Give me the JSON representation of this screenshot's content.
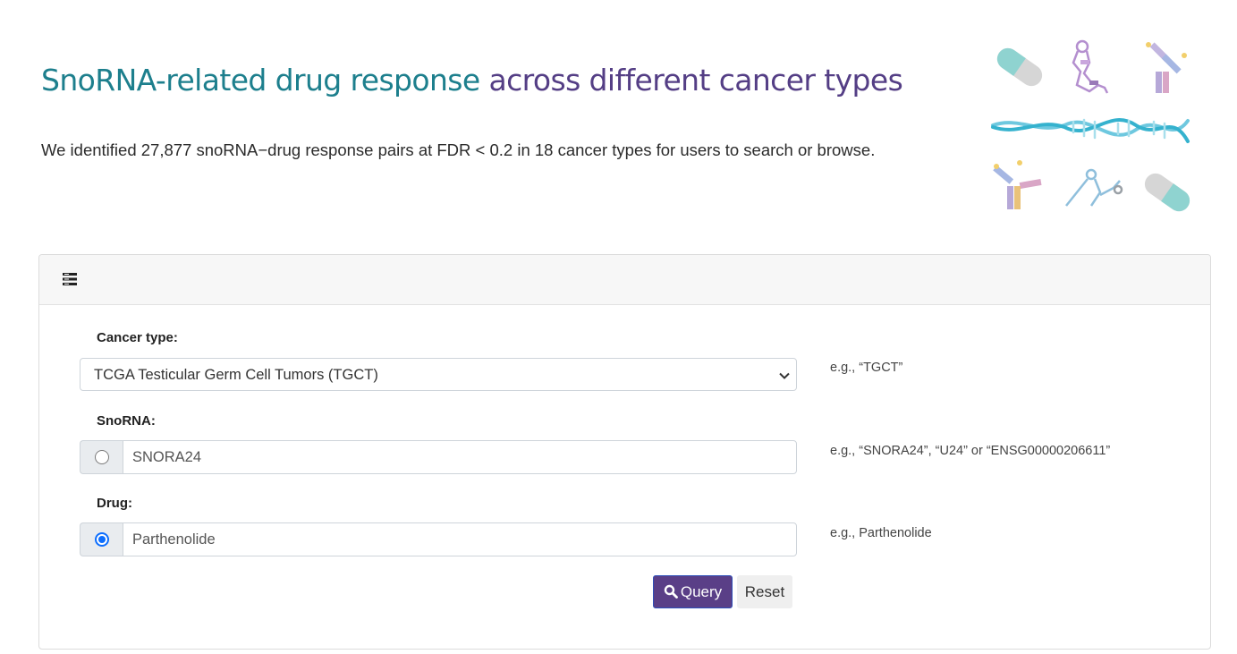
{
  "header": {
    "title_part1": "SnoRNA-related drug response",
    "title_part2": " across different cancer types",
    "subtitle": "We identified 27,877 snoRNA−drug response pairs at FDR < 0.2 in 18 cancer types for users to search or browse."
  },
  "form": {
    "cancer_type": {
      "label": "Cancer type:",
      "selected": "TCGA Testicular Germ Cell Tumors (TGCT)",
      "hint": "e.g., “TGCT”"
    },
    "snorna": {
      "label": "SnoRNA:",
      "value": "SNORA24",
      "checked": false,
      "hint": "e.g., “SNORA24”, “U24” or “ENSG00000206611”"
    },
    "drug": {
      "label": "Drug:",
      "value": "Parthenolide",
      "checked": true,
      "hint": "e.g., Parthenolide"
    },
    "query_label": "Query",
    "reset_label": "Reset"
  },
  "icons": {
    "header_icon": "list-icon",
    "query_icon": "search-icon",
    "select_icon": "chevron-down-icon"
  },
  "colors": {
    "title_teal": "#1d7f8d",
    "title_purple": "#543e85",
    "query_button": "#5a3f87",
    "radio_checked": "#0d6efd"
  }
}
